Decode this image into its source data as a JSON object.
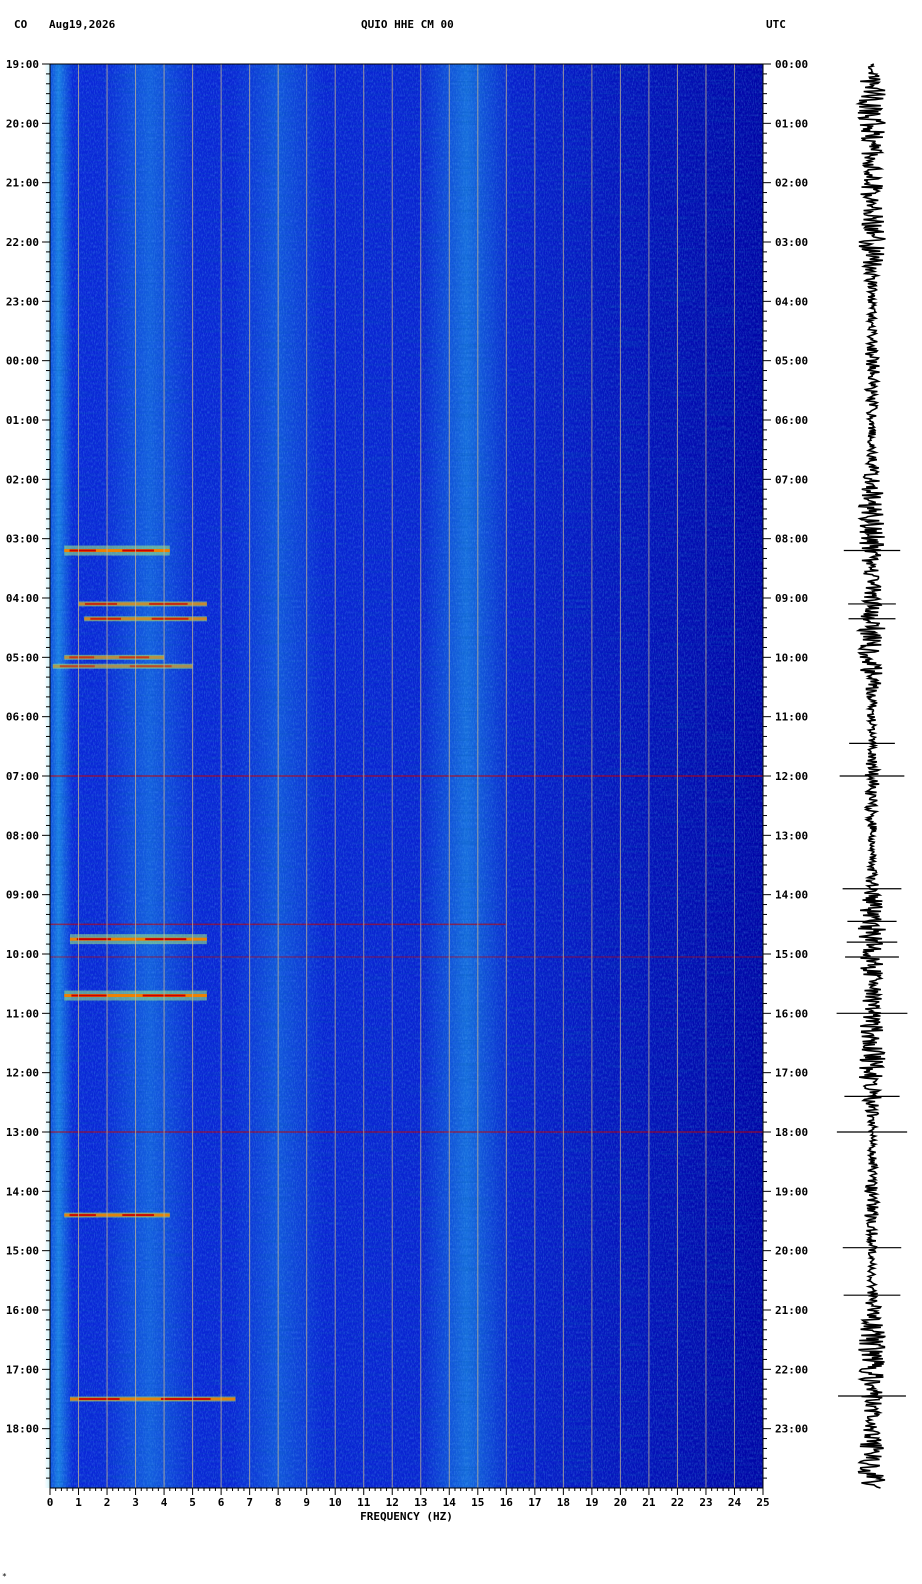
{
  "header": {
    "network": "CO",
    "date": "Aug19,2026",
    "station": "QUIO HHE CM 00",
    "tz": "UTC"
  },
  "footer_mark": "*",
  "chart_data": {
    "type": "heatmap",
    "title": "QUIO HHE CM 00",
    "xlabel": "FREQUENCY (HZ)",
    "xlim": [
      0,
      25
    ],
    "x_ticks": [
      "0",
      "1",
      "2",
      "3",
      "4",
      "5",
      "6",
      "7",
      "8",
      "9",
      "10",
      "11",
      "12",
      "13",
      "14",
      "15",
      "16",
      "17",
      "18",
      "19",
      "20",
      "21",
      "22",
      "23",
      "24",
      "25"
    ],
    "left_time_ticks": [
      "19:00",
      "20:00",
      "21:00",
      "22:00",
      "23:00",
      "00:00",
      "01:00",
      "02:00",
      "03:00",
      "04:00",
      "05:00",
      "06:00",
      "07:00",
      "08:00",
      "09:00",
      "10:00",
      "11:00",
      "12:00",
      "13:00",
      "14:00",
      "15:00",
      "16:00",
      "17:00",
      "18:00"
    ],
    "right_time_ticks": [
      "00:00",
      "01:00",
      "02:00",
      "03:00",
      "04:00",
      "05:00",
      "06:00",
      "07:00",
      "08:00",
      "09:00",
      "10:00",
      "11:00",
      "12:00",
      "13:00",
      "14:00",
      "15:00",
      "16:00",
      "17:00",
      "18:00",
      "19:00",
      "20:00",
      "21:00",
      "22:00",
      "23:00"
    ],
    "duration_hours": 24,
    "grid": true,
    "colormap": [
      "#0000a0",
      "#0a28d8",
      "#1e78f0",
      "#28c8f0",
      "#a0f080",
      "#f0f000",
      "#f08000",
      "#c80000"
    ],
    "energy_bands_hz": [
      {
        "center": 0.3,
        "intensity": 0.55
      },
      {
        "center": 3.5,
        "intensity": 0.35
      },
      {
        "center": 8.0,
        "intensity": 0.3
      },
      {
        "center": 14.6,
        "intensity": 0.45
      }
    ],
    "events": [
      {
        "hour": 8.2,
        "f_min": 0.5,
        "f_max": 4.2,
        "intensity": 1.0
      },
      {
        "hour": 9.1,
        "f_min": 1.0,
        "f_max": 5.5,
        "intensity": 0.7
      },
      {
        "hour": 9.35,
        "f_min": 1.2,
        "f_max": 5.5,
        "intensity": 0.75
      },
      {
        "hour": 10.0,
        "f_min": 0.5,
        "f_max": 4.0,
        "intensity": 0.6
      },
      {
        "hour": 10.15,
        "f_min": 0.1,
        "f_max": 5.0,
        "intensity": 0.5
      },
      {
        "hour": 12.0,
        "f_min": 0.0,
        "f_max": 25.0,
        "intensity": 0.9
      },
      {
        "hour": 14.5,
        "f_min": 0.0,
        "f_max": 16.0,
        "intensity": 0.85
      },
      {
        "hour": 14.75,
        "f_min": 0.7,
        "f_max": 5.5,
        "intensity": 1.0
      },
      {
        "hour": 15.05,
        "f_min": 0.0,
        "f_max": 25.0,
        "intensity": 0.6
      },
      {
        "hour": 15.7,
        "f_min": 0.5,
        "f_max": 5.5,
        "intensity": 1.0
      },
      {
        "hour": 18.0,
        "f_min": 0.0,
        "f_max": 25.0,
        "intensity": 0.85
      },
      {
        "hour": 19.4,
        "f_min": 0.5,
        "f_max": 4.2,
        "intensity": 0.9
      },
      {
        "hour": 22.5,
        "f_min": 0.7,
        "f_max": 6.5,
        "intensity": 0.9
      }
    ],
    "seismogram_spikes_hour": [
      8.2,
      9.1,
      9.35,
      11.45,
      12.0,
      13.9,
      14.45,
      14.8,
      15.05,
      16.0,
      17.4,
      18.0,
      19.95,
      20.75,
      22.45
    ]
  }
}
